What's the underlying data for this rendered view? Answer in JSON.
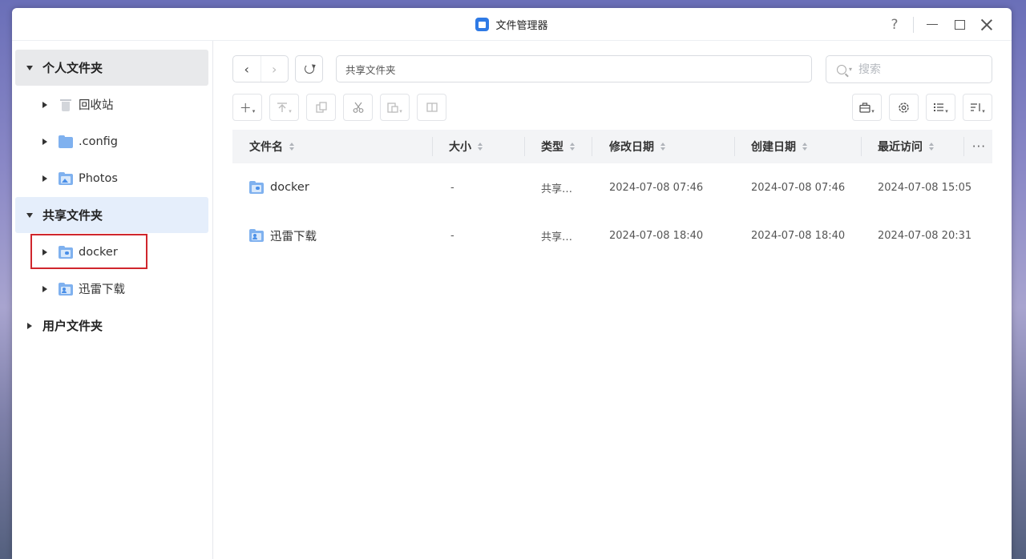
{
  "window": {
    "title": "文件管理器",
    "controls": {
      "help": "?",
      "minimize": "minimize",
      "maximize": "maximize",
      "close": "close"
    }
  },
  "sidebar": {
    "sections": [
      {
        "label": "个人文件夹",
        "expanded": true,
        "children": [
          {
            "label": "回收站",
            "icon": "trash-icon"
          },
          {
            "label": ".config",
            "icon": "folder-icon"
          },
          {
            "label": "Photos",
            "icon": "photo-folder-icon"
          }
        ]
      },
      {
        "label": "共享文件夹",
        "expanded": true,
        "children": [
          {
            "label": "docker",
            "icon": "docker-folder-icon",
            "highlighted": true
          },
          {
            "label": "迅雷下载",
            "icon": "shared-folder-icon"
          }
        ]
      },
      {
        "label": "用户文件夹",
        "expanded": false,
        "children": []
      }
    ],
    "highlight_color": "#d0262d"
  },
  "toolbar": {
    "back": "‹",
    "forward": "›",
    "path": "共享文件夹",
    "search_placeholder": "搜索",
    "actions": [
      "add-icon",
      "upload-icon",
      "copy-icon",
      "cut-icon",
      "paste-icon",
      "compress-icon"
    ],
    "right_actions": [
      "toolbox-icon",
      "settings-icon",
      "view-mode-icon",
      "sort-icon"
    ]
  },
  "table": {
    "columns": [
      "文件名",
      "大小",
      "类型",
      "修改日期",
      "创建日期",
      "最近访问"
    ],
    "rows": [
      {
        "name": "docker",
        "icon": "docker-folder-icon",
        "size": "-",
        "type": "共享…",
        "modified": "2024-07-08 07:46",
        "created": "2024-07-08 07:46",
        "accessed": "2024-07-08 15:05"
      },
      {
        "name": "迅雷下载",
        "icon": "shared-folder-icon",
        "size": "-",
        "type": "共享…",
        "modified": "2024-07-08 18:40",
        "created": "2024-07-08 18:40",
        "accessed": "2024-07-08 20:31"
      }
    ],
    "more": "···"
  },
  "colors": {
    "accent": "#2f7ae5",
    "folder": "#4a8fe8",
    "selected_section": "#e5eefb"
  }
}
